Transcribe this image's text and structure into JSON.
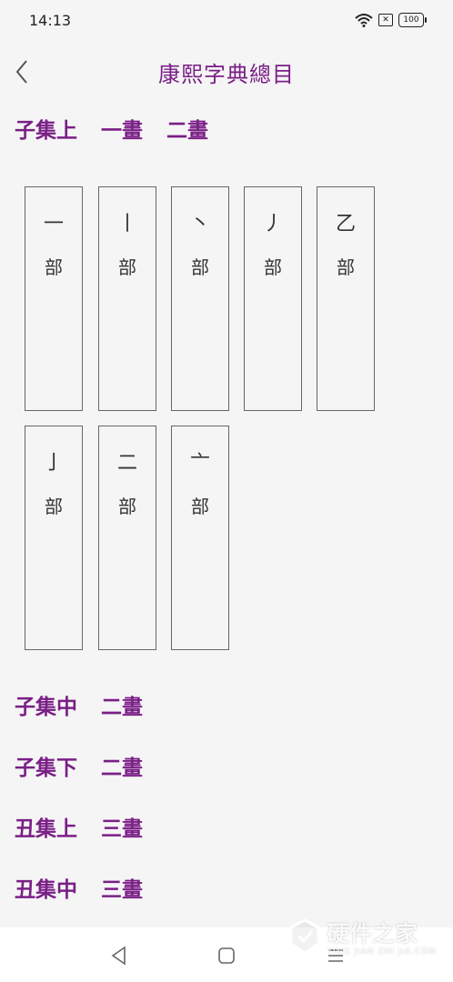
{
  "status_bar": {
    "time": "14:13",
    "battery": "100"
  },
  "header": {
    "title": "康熙字典總目"
  },
  "sections": [
    {
      "volume": "子集上",
      "strokes": [
        "一畫",
        "二畫"
      ]
    },
    {
      "volume": "子集中",
      "strokes": [
        "二畫"
      ]
    },
    {
      "volume": "子集下",
      "strokes": [
        "二畫"
      ]
    },
    {
      "volume": "丑集上",
      "strokes": [
        "三畫"
      ]
    },
    {
      "volume": "丑集中",
      "strokes": [
        "三畫"
      ]
    }
  ],
  "radicals": [
    {
      "char": "一",
      "suffix": "部"
    },
    {
      "char": "丨",
      "suffix": "部"
    },
    {
      "char": "丶",
      "suffix": "部"
    },
    {
      "char": "丿",
      "suffix": "部"
    },
    {
      "char": "乙",
      "suffix": "部"
    },
    {
      "char": "亅",
      "suffix": "部"
    },
    {
      "char": "二",
      "suffix": "部"
    },
    {
      "char": "亠",
      "suffix": "部"
    }
  ],
  "watermark": {
    "title": "硬件之家",
    "subtitle": "YING JIAN ZHI JIA.COM"
  },
  "colors": {
    "accent": "#7a1f86",
    "background": "#f5f5f5",
    "card_border": "#666666"
  },
  "icons": {
    "status": [
      "wifi-icon",
      "sim-icon",
      "battery-icon"
    ],
    "header": [
      "back-arrow-icon"
    ],
    "nav": [
      "nav-back-icon",
      "nav-home-icon",
      "nav-recents-icon"
    ],
    "watermark": [
      "shield-logo-icon"
    ]
  }
}
